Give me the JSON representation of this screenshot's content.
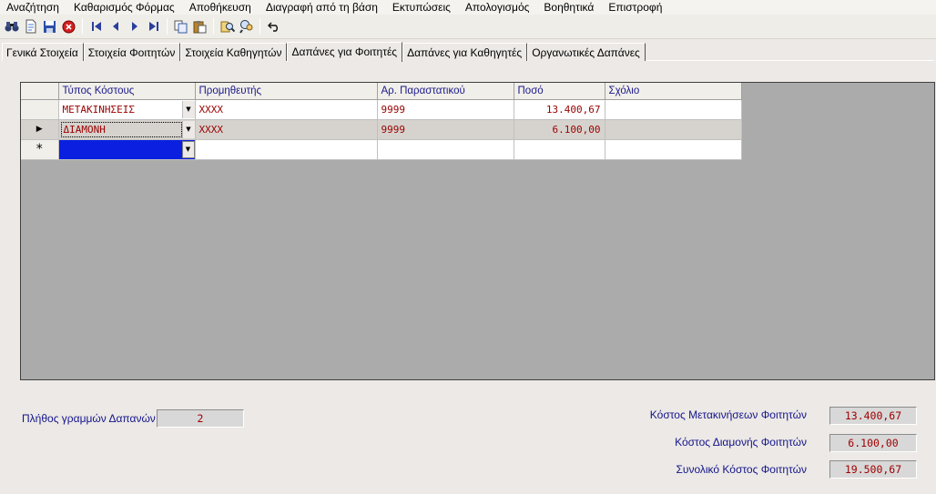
{
  "menu": [
    "Αναζήτηση",
    "Καθαρισμός Φόρμας",
    "Αποθήκευση",
    "Διαγραφή από τη βάση",
    "Εκτυπώσεις",
    "Απολογισμός",
    "Βοηθητικά",
    "Επιστροφή"
  ],
  "toolbar": {
    "icons": [
      "binoculars-icon",
      "new-document-icon",
      "save-icon",
      "stop-icon",
      "first-record-icon",
      "previous-record-icon",
      "next-record-icon",
      "last-record-icon",
      "copy-icon",
      "paste-icon",
      "find-icon",
      "search-records-icon",
      "undo-icon"
    ]
  },
  "tabs": [
    "Γενικά Στοιχεία",
    "Στοιχεία Φοιτητών",
    "Στοιχεία Καθηγητών",
    "Δαπάνες για Φοιτητές",
    "Δαπάνες για Καθηγητές",
    "Οργανωτικές  Δαπάνες"
  ],
  "active_tab": "Δαπάνες για Φοιτητές",
  "grid": {
    "columns": [
      "Τύπος Κόστους",
      "Προμηθευτής",
      "Αρ. Παραστατικού",
      "Ποσό",
      "Σχόλιο"
    ],
    "rows": [
      {
        "type": "ΜΕΤΑΚΙΝΗΣΕΙΣ",
        "supplier": "XXXX",
        "doc": "9999",
        "amount": "13.400,67",
        "comment": ""
      },
      {
        "type": "ΔΙΑΜΟΝΗ",
        "supplier": "XXXX",
        "doc": "9999",
        "amount": "6.100,00",
        "comment": ""
      }
    ],
    "new_row_marker": "*",
    "current_row_marker": "▶"
  },
  "summary": {
    "rows_label": "Πλήθος γραμμών Δαπανών",
    "rows_value": "2",
    "travel_label": "Κόστος Μετακινήσεων Φοιτητών",
    "travel_value": "13.400,67",
    "stay_label": "Κόστος Διαμονής Φοιτητών",
    "stay_value": "6.100,00",
    "total_label": "Συνολικό Κόστος Φοιτητών",
    "total_value": "19.500,67"
  }
}
